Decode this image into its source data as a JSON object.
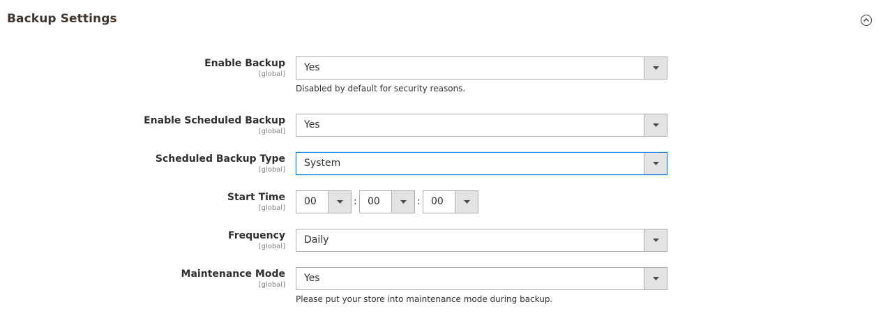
{
  "section": {
    "title": "Backup Settings"
  },
  "fields": {
    "enable_backup": {
      "label": "Enable Backup",
      "scope": "[global]",
      "value": "Yes",
      "note": "Disabled by default for security reasons."
    },
    "enable_scheduled_backup": {
      "label": "Enable Scheduled Backup",
      "scope": "[global]",
      "value": "Yes"
    },
    "scheduled_backup_type": {
      "label": "Scheduled Backup Type",
      "scope": "[global]",
      "value": "System"
    },
    "start_time": {
      "label": "Start Time",
      "scope": "[global]",
      "hour": "00",
      "minute": "00",
      "second": "00",
      "separator": ":"
    },
    "frequency": {
      "label": "Frequency",
      "scope": "[global]",
      "value": "Daily"
    },
    "maintenance_mode": {
      "label": "Maintenance Mode",
      "scope": "[global]",
      "value": "Yes",
      "note": "Please put your store into maintenance mode during backup."
    }
  },
  "icons": {
    "collapse": "chevron-up-circle-icon",
    "dropdown": "caret-down-icon"
  },
  "colors": {
    "focus_border": "#007bdb",
    "arrow_bg": "#e3e3e3"
  }
}
